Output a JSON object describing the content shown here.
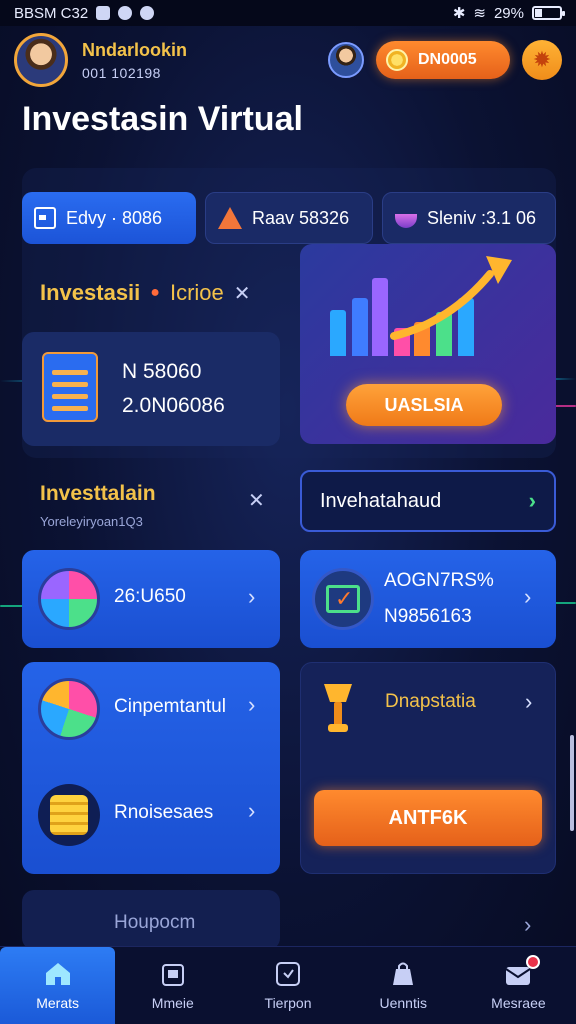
{
  "status_bar": {
    "left_text": "BBSM C32",
    "battery_text": "29%",
    "battery_level": 0.29
  },
  "header": {
    "user_name": "Nndarlookin",
    "user_id": "001 102198",
    "coin_balance": "DN0005"
  },
  "page_title": "Investasin Virtual",
  "tabs": [
    {
      "label": "Edvy · 8086",
      "icon": "wallet-icon"
    },
    {
      "label": "Raav 58326",
      "icon": "triangle-icon"
    },
    {
      "label": "Sleniv :3.1 06",
      "icon": "bowl-icon"
    }
  ],
  "section": {
    "title": "Investasii",
    "subtitle": "Icrioe"
  },
  "stats": {
    "line1": "N 58060",
    "line2": "2.0N06086"
  },
  "chart_card": {
    "button_label": "UASLSIA"
  },
  "row2": {
    "title": "Investtalain",
    "subtitle": "Yoreleyiryoan1Q3",
    "button_label": "Invehatahaud"
  },
  "cards": {
    "card1_label": "26:U650",
    "card2_line1": "AOGN7RS%",
    "card2_line2": "N9856163",
    "card3_label": "Cinpemtantul",
    "card4_label": "Dnapstatia",
    "card5_label": "Rnoisesaes",
    "action_button": "ANTF6K",
    "partial_label": "Houpocm"
  },
  "bottom_nav": [
    {
      "label": "Merats",
      "icon": "home-icon",
      "active": true
    },
    {
      "label": "Mmeie",
      "icon": "building-icon",
      "active": false
    },
    {
      "label": "Tierpon",
      "icon": "clock-icon",
      "active": false
    },
    {
      "label": "Uenntis",
      "icon": "bag-icon",
      "active": false
    },
    {
      "label": "Mesraee",
      "icon": "mail-icon",
      "active": false
    }
  ],
  "colors": {
    "accent_blue": "#2563e8",
    "accent_orange": "#ff8a2e",
    "gold_text": "#f3c24a",
    "bg_dark": "#0b1233"
  }
}
